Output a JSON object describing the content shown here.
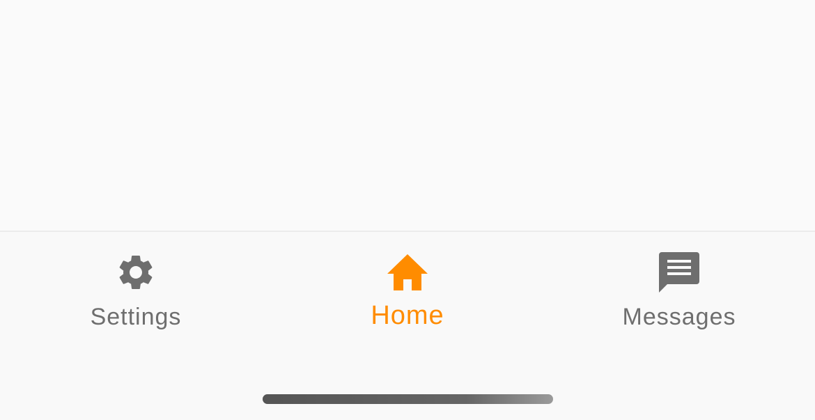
{
  "colors": {
    "active": "#ff8c00",
    "inactive": "#6e6e6e",
    "background": "#fafafa"
  },
  "tab_bar": {
    "tabs": [
      {
        "label": "Settings",
        "icon": "gear-icon",
        "active": false
      },
      {
        "label": "Home",
        "icon": "home-icon",
        "active": true
      },
      {
        "label": "Messages",
        "icon": "message-icon",
        "active": false
      }
    ]
  }
}
